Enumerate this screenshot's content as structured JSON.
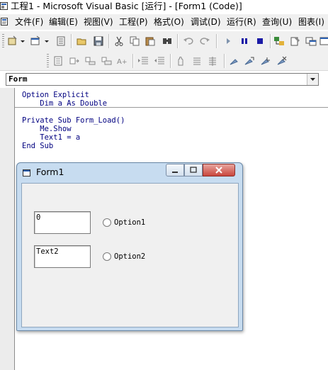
{
  "window": {
    "title": "工程1 - Microsoft Visual Basic [运行] - [Form1 (Code)]"
  },
  "menu": {
    "items": [
      "文件(F)",
      "编辑(E)",
      "视图(V)",
      "工程(P)",
      "格式(O)",
      "调试(D)",
      "运行(R)",
      "查询(U)",
      "图表(I)"
    ]
  },
  "toolbar": {
    "row1_icons": [
      "add-project-icon",
      "add-form-icon",
      "menu-editor-icon",
      "open-icon",
      "save-icon",
      "cut-icon",
      "copy-icon",
      "paste-icon",
      "find-icon",
      "undo-icon",
      "redo-icon",
      "start-icon",
      "break-icon",
      "end-icon",
      "project-explorer-icon",
      "properties-icon",
      "form-layout-icon"
    ],
    "row2_icons": [
      "list-properties-icon",
      "list-constants-icon",
      "quick-info-icon",
      "parameter-info-icon",
      "complete-word-icon",
      "indent-icon",
      "outdent-icon",
      "toggle-breakpoint-icon",
      "comment-block-icon",
      "uncomment-block-icon",
      "toggle-bookmark-icon",
      "next-bookmark-icon",
      "previous-bookmark-icon",
      "clear-bookmarks-icon"
    ]
  },
  "object_combo": {
    "value": "Form"
  },
  "code": {
    "lines": [
      "Option Explicit",
      "    Dim a As Double",
      "Private Sub Form_Load()",
      "    Me.Show",
      "    Text1 = a",
      "End Sub"
    ]
  },
  "form": {
    "title": "Form1",
    "text1_value": "0",
    "text2_value": "Text2",
    "option1_label": "Option1",
    "option2_label": "Option2"
  },
  "colors": {
    "code_keyword": "#000080",
    "form_frame": "#c7dcf0",
    "close_button": "#c9463d"
  }
}
